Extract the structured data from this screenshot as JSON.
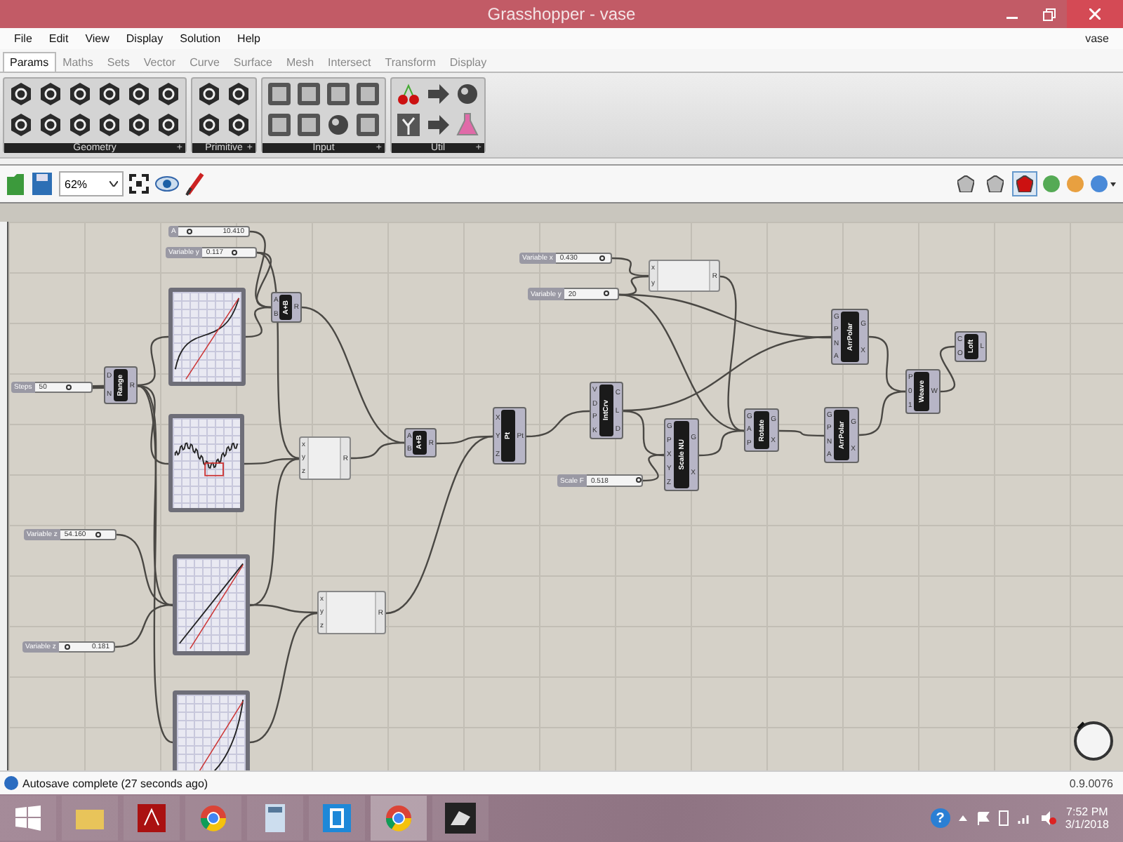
{
  "window": {
    "title": "Grasshopper - vase"
  },
  "menu": [
    {
      "label": "File"
    },
    {
      "label": "Edit"
    },
    {
      "label": "View"
    },
    {
      "label": "Display"
    },
    {
      "label": "Solution"
    },
    {
      "label": "Help"
    }
  ],
  "document_name": "vase",
  "tabs": [
    {
      "label": "Params",
      "selected": true
    },
    {
      "label": "Maths",
      "selected": false
    },
    {
      "label": "Sets",
      "selected": false
    },
    {
      "label": "Vector",
      "selected": false
    },
    {
      "label": "Curve",
      "selected": false
    },
    {
      "label": "Surface",
      "selected": false
    },
    {
      "label": "Mesh",
      "selected": false
    },
    {
      "label": "Intersect",
      "selected": false
    },
    {
      "label": "Transform",
      "selected": false
    },
    {
      "label": "Display",
      "selected": false
    }
  ],
  "ribbon_groups": [
    {
      "label": "Geometry",
      "expand": "+",
      "icons": [
        {
          "kind": "hexagon"
        },
        {
          "kind": "hexagon"
        },
        {
          "kind": "hexagon"
        },
        {
          "kind": "hexagon"
        },
        {
          "kind": "hexagon"
        },
        {
          "kind": "hexagon"
        },
        {
          "kind": "hexagon"
        },
        {
          "kind": "hexagon"
        },
        {
          "kind": "hexagon"
        },
        {
          "kind": "hexagon"
        },
        {
          "kind": "hexagon"
        },
        {
          "kind": "hexagon"
        }
      ]
    },
    {
      "label": "Primitive",
      "expand": "+",
      "icons": [
        {
          "kind": "hexagon"
        },
        {
          "kind": "hexagon"
        },
        {
          "kind": "hexagon"
        },
        {
          "kind": "hexagon"
        }
      ]
    },
    {
      "label": "Input",
      "expand": "+",
      "icons": [
        {
          "kind": "tile"
        },
        {
          "kind": "tile"
        },
        {
          "kind": "tile"
        },
        {
          "kind": "tile"
        },
        {
          "kind": "tile"
        },
        {
          "kind": "ball"
        },
        {
          "kind": "tile"
        },
        {
          "kind": "tile"
        }
      ]
    },
    {
      "label": "Util",
      "expand": "+",
      "icons": [
        {
          "kind": "cherry"
        },
        {
          "kind": "tree"
        },
        {
          "kind": "arrow"
        },
        {
          "kind": "arrow"
        },
        {
          "kind": "ball"
        },
        {
          "kind": "flask"
        }
      ]
    }
  ],
  "toolbar": {
    "zoom": "62%",
    "preview_modes": [
      {
        "selected": false
      },
      {
        "selected": false
      },
      {
        "selected": true
      }
    ]
  },
  "nodes": [
    {
      "kind": "slider",
      "label": "A",
      "value": "10.410",
      "level": 0.15
    },
    {
      "kind": "slider",
      "label": "Variable y",
      "value": "0.117",
      "level": 0.6
    },
    {
      "kind": "graph"
    },
    {
      "kind": "component",
      "label": "A+B",
      "inputs": [
        "A",
        "B"
      ],
      "outputs": [
        "R"
      ]
    },
    {
      "kind": "slider",
      "label": "Steps",
      "value": "50",
      "level": 0.6
    },
    {
      "kind": "component",
      "label": "Range",
      "inputs": [
        "D",
        "N"
      ],
      "outputs": [
        "R"
      ]
    },
    {
      "kind": "graph"
    },
    {
      "kind": "expression",
      "inputs": [
        "x",
        "y",
        "z"
      ],
      "outputs": [
        "R"
      ]
    },
    {
      "kind": "component",
      "label": "A+B",
      "inputs": [
        "A",
        "B"
      ],
      "outputs": [
        "R"
      ]
    },
    {
      "kind": "component",
      "label": "Pt",
      "inputs": [
        "X",
        "Y",
        "Z"
      ],
      "outputs": [
        "Pt"
      ]
    },
    {
      "kind": "slider",
      "label": "Variable x",
      "value": "0.430",
      "level": 0.85
    },
    {
      "kind": "slider",
      "label": "Variable y",
      "value": "20",
      "level": 0.8
    },
    {
      "kind": "expression",
      "inputs": [
        "x",
        "y"
      ],
      "outputs": [
        "R"
      ]
    },
    {
      "kind": "component",
      "label": "IntCrv",
      "inputs": [
        "V",
        "D",
        "P",
        "K"
      ],
      "outputs": [
        "C",
        "L",
        "D"
      ]
    },
    {
      "kind": "component",
      "label": "Scale NU",
      "inputs": [
        "G",
        "P",
        "X",
        "Y",
        "Z"
      ],
      "outputs": [
        "G",
        "X"
      ]
    },
    {
      "kind": "slider",
      "label": "Scale F",
      "value": "0.518",
      "level": 0.95
    },
    {
      "kind": "component",
      "label": "Rotate",
      "inputs": [
        "G",
        "A",
        "P"
      ],
      "outputs": [
        "G",
        "X"
      ]
    },
    {
      "kind": "component",
      "label": "ArrPolar",
      "inputs": [
        "G",
        "P",
        "N",
        "A"
      ],
      "outputs": [
        "G",
        "X"
      ]
    },
    {
      "kind": "component",
      "label": "ArrPolar",
      "inputs": [
        "G",
        "P",
        "N",
        "A"
      ],
      "outputs": [
        "G",
        "X"
      ]
    },
    {
      "kind": "component",
      "label": "Weave",
      "inputs": [
        "P",
        "0",
        "1"
      ],
      "outputs": [
        "W"
      ]
    },
    {
      "kind": "component",
      "label": "Loft",
      "inputs": [
        "C",
        "O"
      ],
      "outputs": [
        "L"
      ]
    },
    {
      "kind": "slider",
      "label": "Variable z",
      "value": "54.160",
      "level": 0.7
    },
    {
      "kind": "graph"
    },
    {
      "kind": "expression",
      "inputs": [
        "x",
        "y",
        "z"
      ],
      "outputs": [
        "R"
      ]
    },
    {
      "kind": "slider",
      "label": "Variable z",
      "value": "0.181",
      "level": 0.15
    },
    {
      "kind": "graph"
    }
  ],
  "status_bar": {
    "message": "Autosave complete (27 seconds ago)",
    "version": "0.9.0076"
  },
  "taskbar": {
    "apps": [
      {
        "kind": "folder",
        "selected": false
      },
      {
        "kind": "pdf",
        "selected": false
      },
      {
        "kind": "browser",
        "selected": false
      },
      {
        "kind": "calculator",
        "selected": false
      },
      {
        "kind": "window",
        "selected": false
      },
      {
        "kind": "browser",
        "selected": true
      },
      {
        "kind": "rhino",
        "selected": false
      }
    ],
    "help": "?",
    "time": "7:52 PM",
    "date": "3/1/2018"
  }
}
